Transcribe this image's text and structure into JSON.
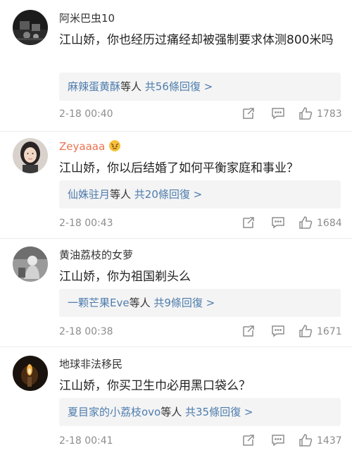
{
  "comments": [
    {
      "username": "阿米巴虫10",
      "vip": false,
      "text": "江山娇，你也经历过痛经却被强制要求体测800米吗",
      "replies": {
        "who": "麻辣蛋黄酥",
        "rest": "等人 ",
        "count": "共56條回復 >"
      },
      "time": "2-18 00:40",
      "likes": "1783",
      "avatar_icon": "avatar-dark-scene"
    },
    {
      "username": "Zeyaaaa",
      "vip": true,
      "text": "江山娇，你以后结婚了如何平衡家庭和事业？",
      "replies": {
        "who": "仙姝驻月",
        "rest": "等人 ",
        "count": "共20條回復 >"
      },
      "time": "2-18 00:43",
      "likes": "1684",
      "avatar_icon": "avatar-woman-portrait"
    },
    {
      "username": "黄油荔枝的女萝",
      "vip": false,
      "text": "江山娇，你为祖国剃头么",
      "replies": {
        "who": "一颗芒果Eve",
        "rest": "等人 ",
        "count": "共9條回復 >"
      },
      "time": "2-18 00:38",
      "likes": "1671",
      "avatar_icon": "avatar-grey-figure"
    },
    {
      "username": "地球非法移民",
      "vip": false,
      "text": "江山娇，你买卫生巾必用黑口袋么？",
      "replies": {
        "who": "夏目家的小荔枝ovo",
        "rest": "等人 ",
        "count": "共35條回復 >"
      },
      "time": "2-18 00:41",
      "likes": "1437",
      "avatar_icon": "avatar-candle-light"
    }
  ],
  "colors": {
    "link": "#4d7cad",
    "vip_name": "#eb7350",
    "meta": "#8d8d8d",
    "reply_bg": "#f4f4f4"
  }
}
